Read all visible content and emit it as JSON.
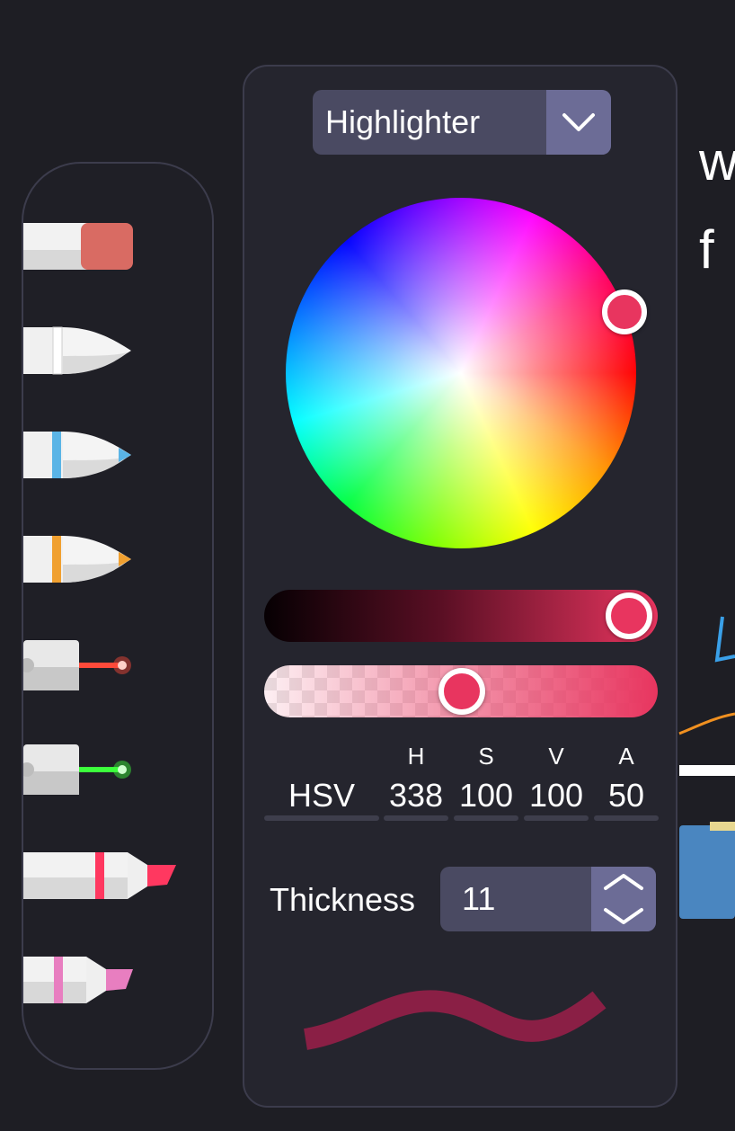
{
  "canvas": {
    "partial_text": [
      "w",
      "f"
    ]
  },
  "tools": [
    {
      "name": "eraser",
      "color": "#d96b63"
    },
    {
      "name": "pen-white",
      "color": "#ffffff"
    },
    {
      "name": "pen-blue",
      "color": "#5ab4e6"
    },
    {
      "name": "pen-orange",
      "color": "#f0a030"
    },
    {
      "name": "laser-red",
      "color": "#ff4a3a"
    },
    {
      "name": "laser-green",
      "color": "#3cff3c"
    },
    {
      "name": "highlighter-red",
      "color": "#ff3860"
    },
    {
      "name": "highlighter-pink",
      "color": "#e87ec0"
    }
  ],
  "panel": {
    "tool_type": "Highlighter",
    "color_model": "HSV",
    "channels": [
      {
        "label": "H",
        "value": "338"
      },
      {
        "label": "S",
        "value": "100"
      },
      {
        "label": "V",
        "value": "100"
      },
      {
        "label": "A",
        "value": "50"
      }
    ],
    "value_slider_fraction": 1.0,
    "alpha_slider_fraction": 0.5,
    "thickness_label": "Thickness",
    "thickness_value": "11",
    "selected_color": "#e8355f",
    "preview_color": "#8a1f45"
  }
}
